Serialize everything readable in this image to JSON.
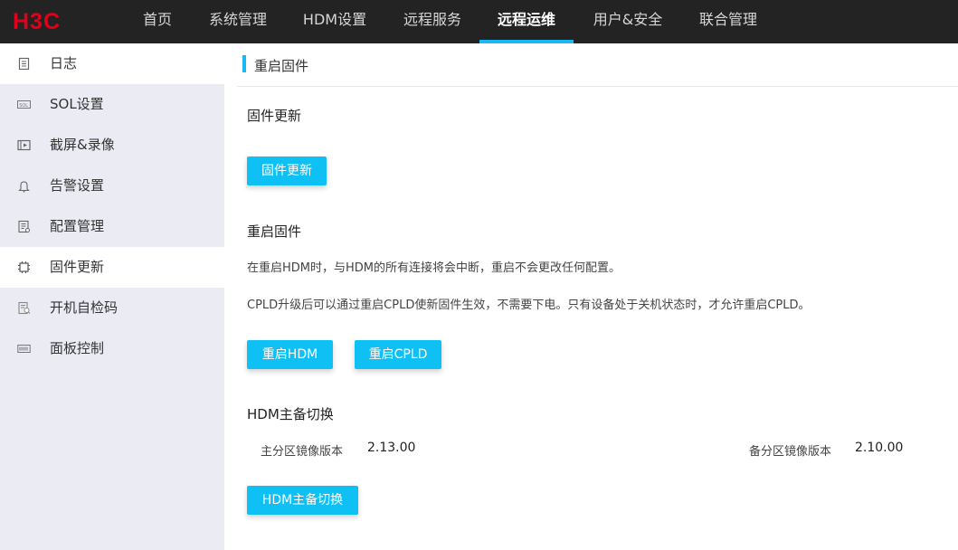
{
  "brand": {
    "logo_text": "H3C",
    "logo_color": "#e1001a"
  },
  "nav": [
    {
      "label": "首页",
      "active": false
    },
    {
      "label": "系统管理",
      "active": false
    },
    {
      "label": "HDM设置",
      "active": false
    },
    {
      "label": "远程服务",
      "active": false
    },
    {
      "label": "远程运维",
      "active": true
    },
    {
      "label": "用户&安全",
      "active": false
    },
    {
      "label": "联合管理",
      "active": false
    }
  ],
  "sidebar": {
    "items": [
      {
        "label": "日志",
        "icon": "log-icon"
      },
      {
        "label": "SOL设置",
        "icon": "sol-icon"
      },
      {
        "label": "截屏&录像",
        "icon": "video-icon"
      },
      {
        "label": "告警设置",
        "icon": "bell-icon"
      },
      {
        "label": "配置管理",
        "icon": "config-icon"
      },
      {
        "label": "固件更新",
        "icon": "chip-icon",
        "active": true
      },
      {
        "label": "开机自检码",
        "icon": "post-code-icon"
      },
      {
        "label": "面板控制",
        "icon": "panel-icon"
      }
    ]
  },
  "main": {
    "page_title": "重启固件",
    "firmware_update": {
      "title": "固件更新",
      "button": "固件更新"
    },
    "restart_firmware": {
      "title": "重启固件",
      "desc1": "在重启HDM时，与HDM的所有连接将会中断，重启不会更改任何配置。",
      "desc2": "CPLD升级后可以通过重启CPLD使新固件生效，不需要下电。只有设备处于关机状态时，才允许重启CPLD。",
      "restart_hdm_button": "重启HDM",
      "restart_cpld_button": "重启CPLD"
    },
    "hdm_switch": {
      "title": "HDM主备切换",
      "primary_label": "主分区镜像版本",
      "primary_value": "2.13.00",
      "backup_label": "备分区镜像版本",
      "backup_value": "2.10.00",
      "button": "HDM主备切换"
    }
  },
  "colors": {
    "accent": "#1ab8f2",
    "button": "#0fc0f5",
    "topbar": "#232323",
    "sidebar_bg": "#ebebf3"
  }
}
